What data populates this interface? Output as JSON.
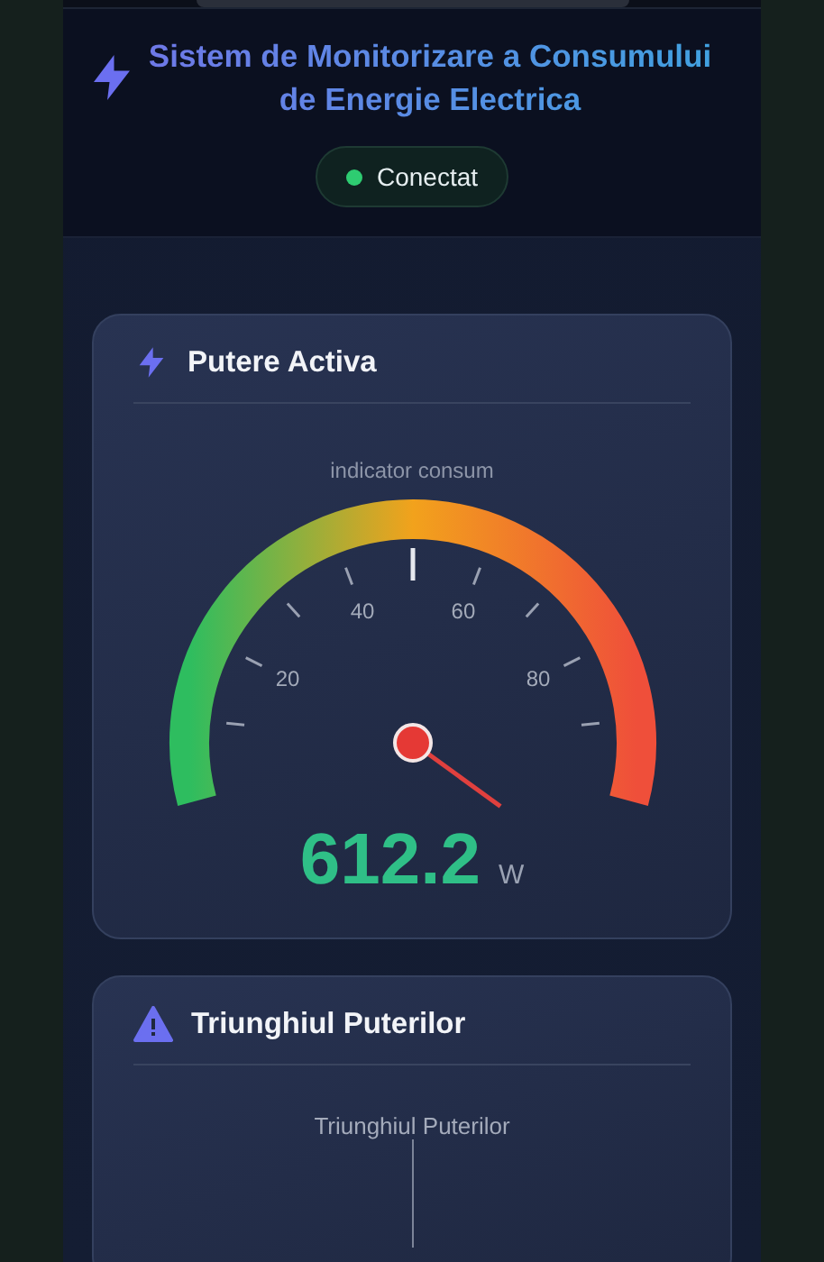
{
  "header": {
    "title": "Sistem de Monitorizare a Consumului de Energie Electrica",
    "status": {
      "label": "Conectat",
      "connected": true
    }
  },
  "power_card": {
    "title": "Putere Activa",
    "gauge": {
      "title": "indicator consum",
      "tick_labels": [
        "20",
        "40",
        "60",
        "80"
      ],
      "value": "612.2",
      "unit": "W"
    }
  },
  "triangle_card": {
    "title": "Triunghiul Puterilor",
    "chart_title": "Triunghiul Puterilor"
  }
}
